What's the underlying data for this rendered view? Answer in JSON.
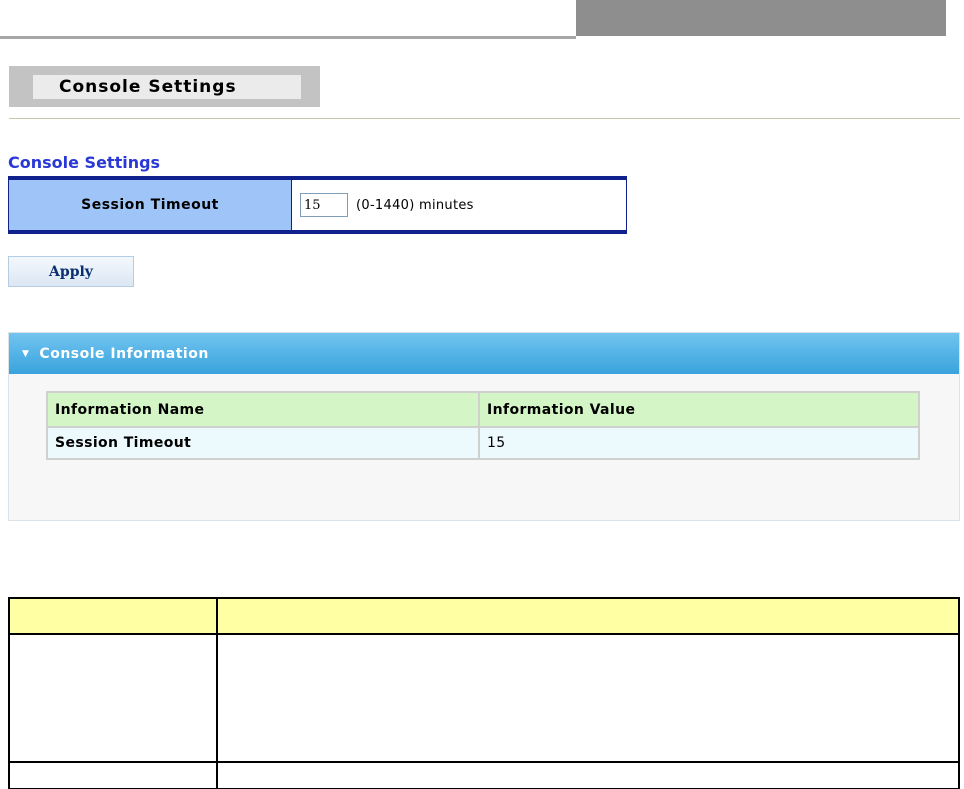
{
  "page": {
    "title": "Console Settings"
  },
  "settings": {
    "section_title": "Console Settings",
    "session_timeout_label": "Session Timeout",
    "session_timeout_value": "15",
    "session_timeout_hint": "(0-1440) minutes",
    "apply_label": "Apply"
  },
  "info": {
    "panel_title": "Console Information",
    "columns": [
      "Information Name",
      "Information Value"
    ],
    "rows": [
      {
        "name": "Session Timeout",
        "value": "15"
      }
    ]
  },
  "colors": {
    "section_title": "#2a39d6",
    "table_border": "#10208c",
    "label_bg": "#9fc5f8",
    "panel_header": "#52b2e6",
    "info_header_row": "#d4f5c6",
    "info_data_row": "#ecfafd",
    "doc_header_row": "#ffffa4"
  },
  "icons": {
    "panel_toggle": "triangle-down-icon"
  }
}
